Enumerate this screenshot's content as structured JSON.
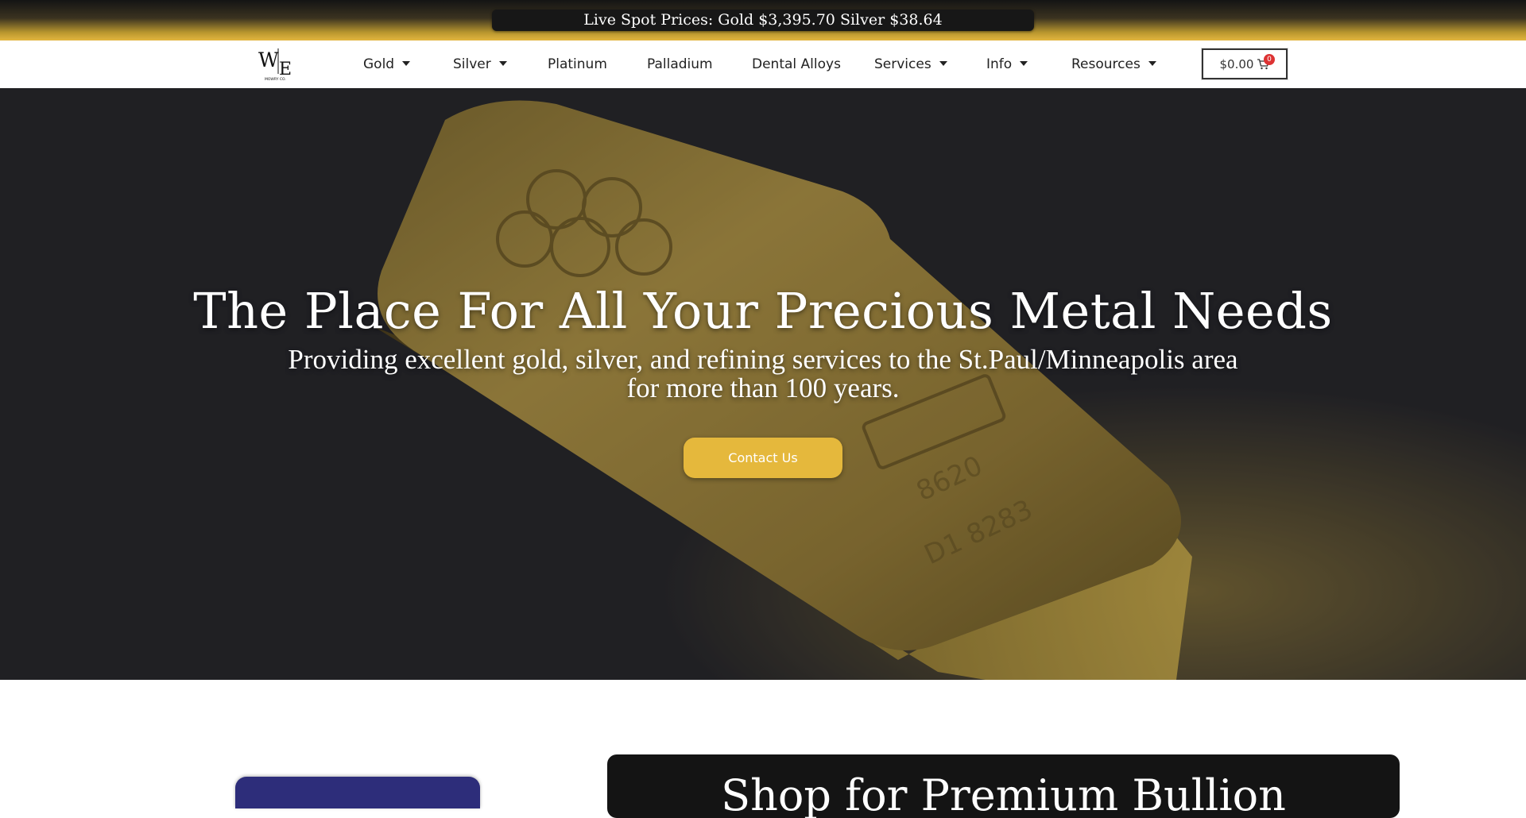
{
  "ticker": {
    "text": "Live Spot Prices: Gold $3,395.70 Silver $38.64"
  },
  "logo": {
    "mark": "W|E",
    "sub": "MOWRY CO."
  },
  "nav": {
    "items": [
      {
        "label": "Gold",
        "dropdown": true
      },
      {
        "label": "Silver",
        "dropdown": true
      },
      {
        "label": "Platinum",
        "dropdown": false
      },
      {
        "label": "Palladium",
        "dropdown": false
      },
      {
        "label": "Dental Alloys",
        "dropdown": false
      },
      {
        "label": "Services",
        "dropdown": true
      },
      {
        "label": "Info",
        "dropdown": true
      },
      {
        "label": "Resources",
        "dropdown": true
      }
    ],
    "cart_total": "$0.00",
    "cart_count": "0"
  },
  "hero": {
    "title": "The Place For All Your Precious Metal Needs",
    "subtitle_line1": "Providing excellent gold, silver, and refining services to the St.Paul/Minneapolis area",
    "subtitle_line2": "for more than 100 years.",
    "cta_label": "Contact Us"
  },
  "section": {
    "title": "Shop for Premium Bullion"
  },
  "colors": {
    "accent": "#e5b83c",
    "dark": "#141414",
    "badge": "#d33333"
  }
}
